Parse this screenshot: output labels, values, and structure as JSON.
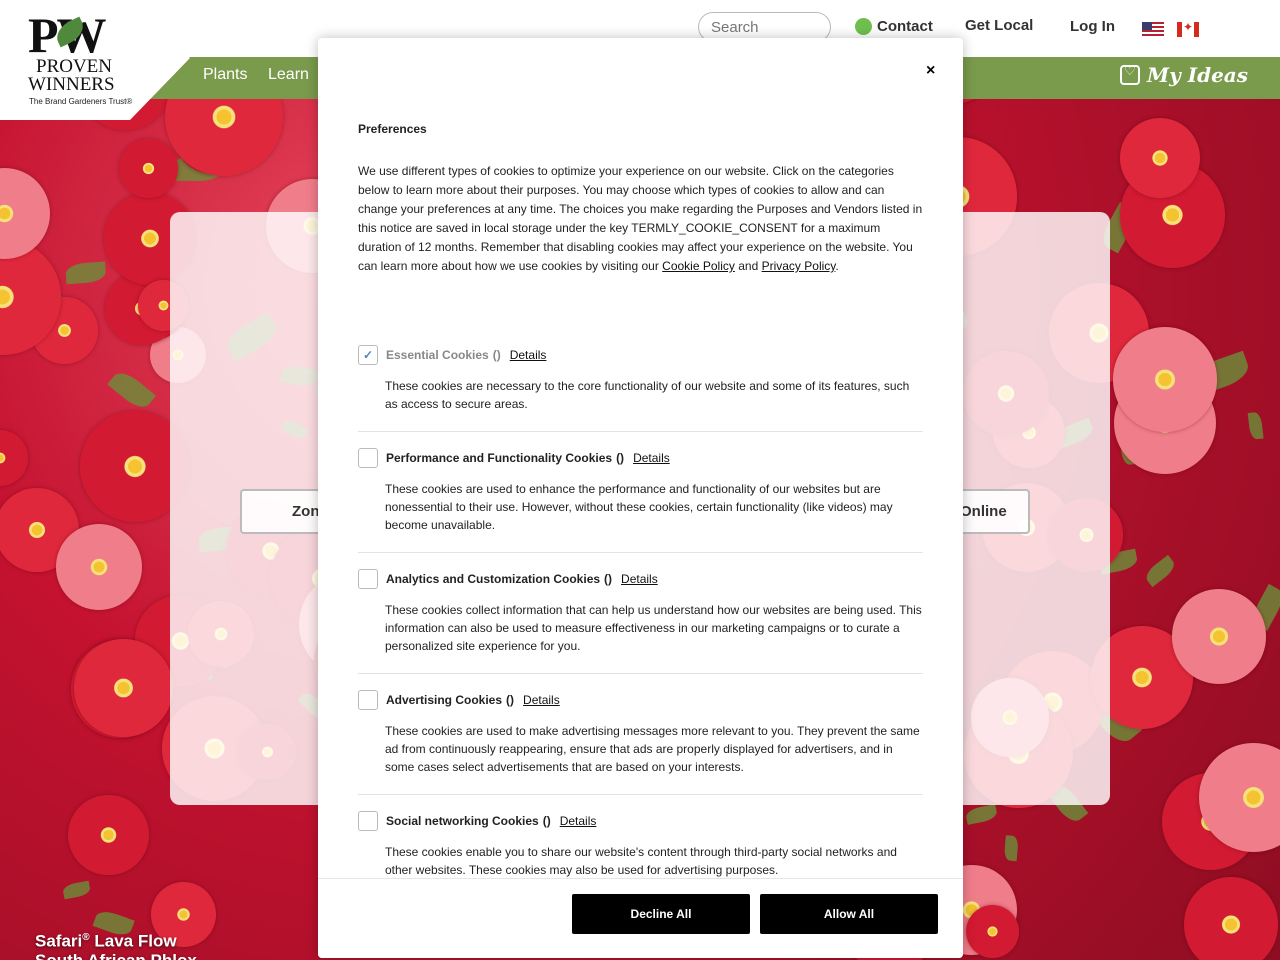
{
  "header": {
    "logo": {
      "brand_initials": "PW",
      "brand_line1": "PROVEN",
      "brand_line2": "WINNERS",
      "tagline": "The Brand Gardeners Trust®"
    },
    "search_placeholder": "Search",
    "contact_label": "Contact",
    "get_local_label": "Get Local",
    "login_label": "Log In",
    "nav": {
      "plants": "Plants",
      "learn": "Learn"
    },
    "my_ideas_label": "My Ideas"
  },
  "page": {
    "left_button_partial": "Zon",
    "right_button_partial": "Online",
    "caption_name": "Safari",
    "caption_trademark": "®",
    "caption_variety": "Lava Flow",
    "caption_common": "South African Phlox"
  },
  "modal": {
    "close_label": "×",
    "title": "Preferences",
    "intro_text": "We use different types of cookies to optimize your experience on our website. Click on the categories below to learn more about their purposes. You may choose which types of cookies to allow and can change your preferences at any time. The choices you make regarding the Purposes and Vendors listed in this notice are saved in local storage under the key TERMLY_COOKIE_CONSENT for a maximum duration of 12 months. Remember that disabling cookies may affect your experience on the website. You can learn more about how we use cookies by visiting our",
    "cookie_policy_link": "Cookie Policy",
    "and_text": "and",
    "privacy_policy_link": "Privacy Policy",
    "period": ".",
    "categories": [
      {
        "name": "Essential Cookies",
        "count": "()",
        "details": "Details",
        "checked": true,
        "disabled": true,
        "description": "These cookies are necessary to the core functionality of our website and some of its features, such as access to secure areas."
      },
      {
        "name": "Performance and Functionality Cookies",
        "count": "()",
        "details": "Details",
        "checked": false,
        "disabled": false,
        "description": "These cookies are used to enhance the performance and functionality of our websites but are nonessential to their use. However, without these cookies, certain functionality (like videos) may become unavailable."
      },
      {
        "name": "Analytics and Customization Cookies",
        "count": "()",
        "details": "Details",
        "checked": false,
        "disabled": false,
        "description": "These cookies collect information that can help us understand how our websites are being used. This information can also be used to measure effectiveness in our marketing campaigns or to curate a personalized site experience for you."
      },
      {
        "name": "Advertising Cookies",
        "count": "()",
        "details": "Details",
        "checked": false,
        "disabled": false,
        "description": "These cookies are used to make advertising messages more relevant to you. They prevent the same ad from continuously reappearing, ensure that ads are properly displayed for advertisers, and in some cases select advertisements that are based on your interests."
      },
      {
        "name": "Social networking Cookies",
        "count": "()",
        "details": "Details",
        "checked": false,
        "disabled": false,
        "description": "These cookies enable you to share our website's content through third-party social networks and other websites. These cookies may also be used for advertising purposes."
      }
    ],
    "decline_label": "Decline All",
    "allow_label": "Allow All"
  },
  "colors": {
    "nav_green": "#7a9a4c",
    "contact_dot": "#6fbf4f",
    "button_black": "#000000"
  }
}
